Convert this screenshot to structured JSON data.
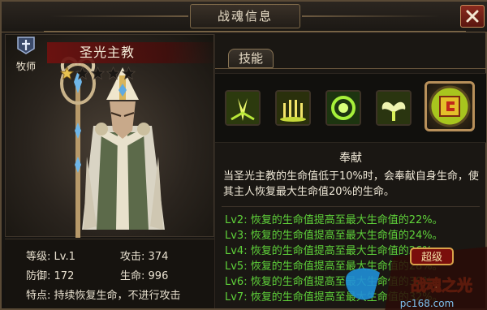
{
  "window": {
    "title": "战魂信息",
    "close_icon": "close-icon"
  },
  "hero": {
    "class_label": "牧师",
    "name": "圣光主教",
    "stars_total": 5,
    "stars_lit": 1,
    "stats": {
      "level_label": "等级:",
      "level_value": "Lv.1",
      "attack_label": "攻击:",
      "attack_value": "374",
      "defense_label": "防御:",
      "defense_value": "172",
      "hp_label": "生命:",
      "hp_value": "996",
      "trait_label": "特点:",
      "trait_value": "持续恢复生命，不进行攻击"
    }
  },
  "skills": {
    "tab_label": "技能",
    "icons": [
      "burst-icon",
      "candles-icon",
      "swirl-icon",
      "wings-icon",
      "rune-icon"
    ],
    "selected_index": 4,
    "selected_name": "奉献",
    "description": "当圣光主教的生命值低于10%时，会奉献自身生命，使其主人恢复最大生命值20%的生命。",
    "levels": [
      "Lv2:  恢复的生命值提高至最大生命值的22%。",
      "Lv3:  恢复的生命值提高至最大生命值的24%。",
      "Lv4:  恢复的生命值提高至最大生命值的26%。",
      "Lv5:  恢复的生命值提高至最大生命值的28%。",
      "Lv6:  恢复的生命值提高至最大生命值的30%。",
      "Lv7:  恢复的生命值提高至最大生命值的32%。"
    ]
  },
  "watermark": {
    "badge_text": "超级",
    "logo_text": "战魂之光",
    "site_text": "pc168.com"
  },
  "colors": {
    "level_text": "#5fd23a",
    "frame": "#7d6848",
    "name_plate": "#6e1210"
  }
}
